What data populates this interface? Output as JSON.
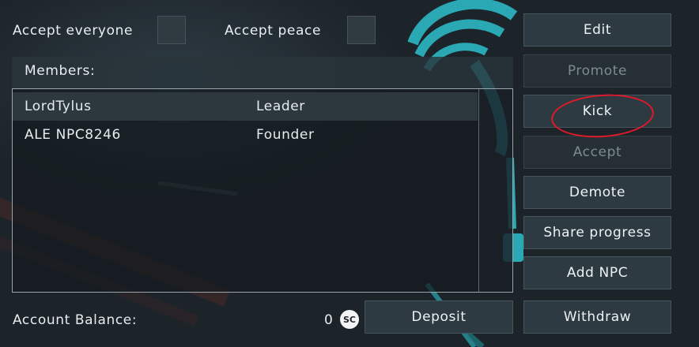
{
  "settings": {
    "accept_everyone_label": "Accept everyone",
    "accept_peace_label": "Accept peace"
  },
  "members": {
    "title": "Members:",
    "rows": [
      {
        "name": "LordTylus",
        "rank": "Leader"
      },
      {
        "name": "ALE NPC8246",
        "rank": "Founder"
      }
    ]
  },
  "actions": {
    "edit": "Edit",
    "promote": "Promote",
    "kick": "Kick",
    "accept": "Accept",
    "demote": "Demote",
    "share_progress": "Share progress",
    "add_npc": "Add NPC",
    "withdraw": "Withdraw",
    "deposit": "Deposit"
  },
  "account": {
    "label": "Account Balance:",
    "balance": "0",
    "currency_icon": "SC"
  },
  "colors": {
    "accent_teal": "#2fb8c4",
    "annotation_red": "#e0192a"
  }
}
